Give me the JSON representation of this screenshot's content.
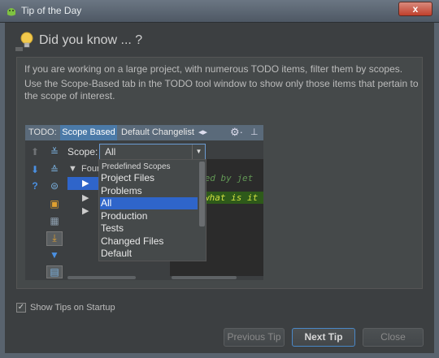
{
  "window": {
    "title": "Tip of the Day",
    "close_glyph": "x",
    "app_icon": "android-icon"
  },
  "header": {
    "icon": "lightbulb-icon",
    "title": "Did you know ... ?"
  },
  "tip": {
    "paragraph1": "If you are working on a large project, with numerous TODO items, filter them by scopes.",
    "paragraph2": "Use the Scope-Based tab in the TODO tool window to show only those items that pertain to the scope of interest."
  },
  "illustration": {
    "toolwindow_label": "TODO:",
    "tabs": [
      "Scope Based",
      "Default Changelist"
    ],
    "arrows_glyph": "◂▸",
    "gear_glyph": "⚙·",
    "hide_glyph": "⊥",
    "scope_label": "Scope:",
    "scope_value": "All",
    "tree_root": "Four",
    "dropdown_group": "Predefined Scopes",
    "dropdown_items": [
      "Project Files",
      "Problems",
      "All",
      "Production",
      "Tests",
      "Changed Files",
      "Default"
    ],
    "selected_index": 2,
    "code_line1": "ted by jet",
    "code_line2": "what is it",
    "colors": {
      "tab_active": "#4b7aa8",
      "selection": "#2f65ca",
      "code_comment": "#629755",
      "code_todo": "#d0e040"
    }
  },
  "footer": {
    "show_tips_label": "Show Tips on Startup",
    "show_tips_checked": true,
    "check_glyph": "✓",
    "buttons": {
      "previous": "Previous Tip",
      "next": "Next Tip",
      "close": "Close"
    }
  }
}
